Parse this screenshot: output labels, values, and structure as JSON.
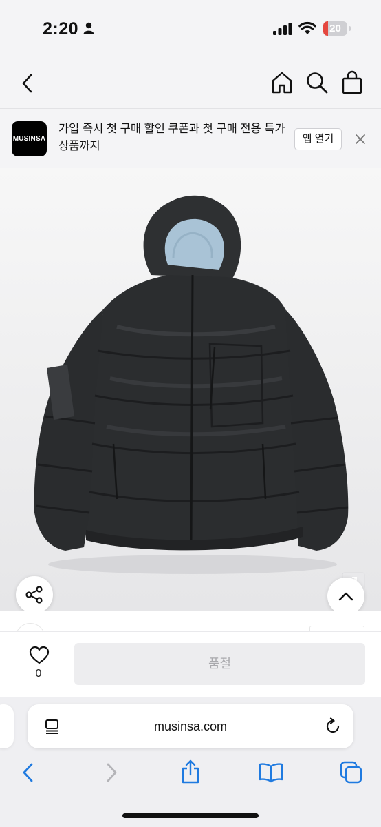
{
  "status_bar": {
    "time": "2:20",
    "battery_level": "20",
    "battery_fraction": 0.2,
    "battery_color": "#e5473f",
    "icons": [
      "person-icon",
      "signal-icon",
      "wifi-icon",
      "battery-icon"
    ]
  },
  "nav": {
    "icons": [
      "chevron-left-icon",
      "home-icon",
      "search-icon",
      "shopping-bag-icon"
    ]
  },
  "app_banner": {
    "logo_text": "MUSINSA",
    "message": "가입 즉시 첫 구매 할인 쿠폰과 첫 구매 전용 특가 상품까지",
    "open_button": "앱 열기",
    "close_icon": "close-icon"
  },
  "product": {
    "image_icon": "hooded-puffer-jacket",
    "colors": {
      "jacket": "#2b2d2f",
      "hood_lining": "#a9c3d6"
    }
  },
  "floating": {
    "share_icon": "share-icon",
    "scroll_top_icon": "chevron-up-icon"
  },
  "purchase_bar": {
    "like_icon": "heart-icon",
    "like_count": "0",
    "status_button": "품절"
  },
  "safari": {
    "url": "musinsa.com",
    "reader_icon": "reader-icon",
    "reload_icon": "reload-icon",
    "toolbar_icons": [
      "back-icon",
      "forward-icon",
      "share-icon",
      "bookmarks-icon",
      "tabs-icon"
    ],
    "accent": "#1f7ae0"
  }
}
